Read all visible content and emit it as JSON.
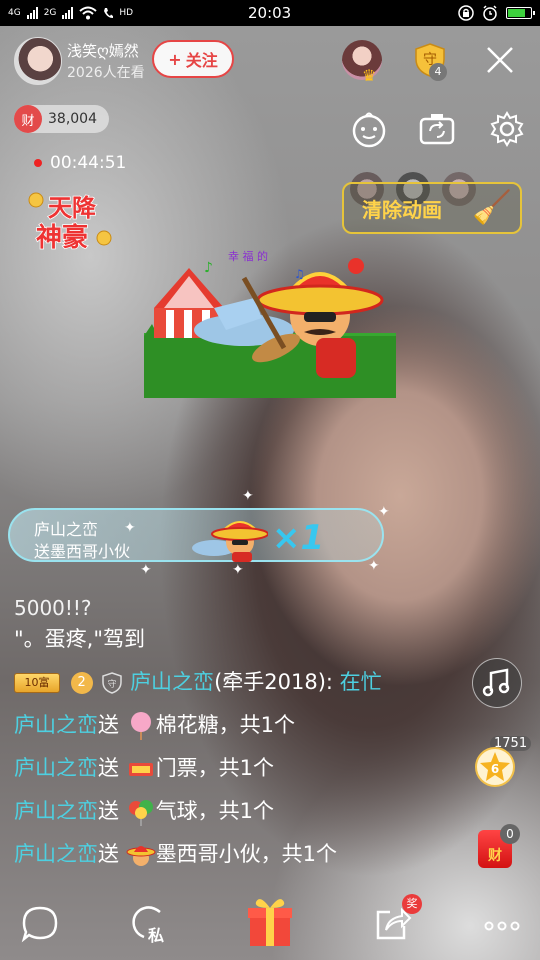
{
  "status_bar": {
    "network_1": "4G",
    "network_2": "2G",
    "wifi_label": "HD",
    "time": "20:03",
    "battery_percent": 85
  },
  "header": {
    "host_name": "浅笑ღ嫣然",
    "viewer_count": "2026人在看",
    "follow_label": "关注",
    "follow_plus": "+",
    "guard_count": "4"
  },
  "wealth": {
    "icon_text": "财",
    "value": "38,004"
  },
  "timer": "00:44:51",
  "rich_badge": {
    "line1": "天降",
    "line2": "神豪"
  },
  "clear_animation_label": "清除动画",
  "gift_toast": {
    "user": "庐山之峦",
    "message": "送墨西哥小伙",
    "count": "×1"
  },
  "chat": {
    "cut_line": "5000!!?",
    "lines": [
      {
        "type": "plain",
        "text": "\"。蛋疼,\"驾到"
      },
      {
        "type": "msg",
        "level_badge": "10富",
        "level_num": "2",
        "user": "庐山之峦",
        "suffix": "(牵手2018):",
        "text": " 在忙"
      },
      {
        "type": "gift",
        "user": "庐山之峦",
        "verb": "送",
        "gift": "棉花糖，共1个"
      },
      {
        "type": "gift",
        "user": "庐山之峦",
        "verb": "送",
        "gift": "门票，共1个"
      },
      {
        "type": "gift",
        "user": "庐山之峦",
        "verb": "送",
        "gift": "气球，共1个"
      },
      {
        "type": "gift",
        "user": "庐山之峦",
        "verb": "送",
        "gift": "墨西哥小伙，共1个"
      }
    ]
  },
  "side": {
    "star_count": "1751",
    "star_level": "6",
    "redbag_count": "0",
    "redbag_label": "财"
  },
  "bottom_bar": {
    "private_label": "私",
    "prize_badge": "奖"
  },
  "colors": {
    "accent_red": "#e64545",
    "username_cyan": "#4dd0e1",
    "clear_gold": "#ffd34a"
  }
}
